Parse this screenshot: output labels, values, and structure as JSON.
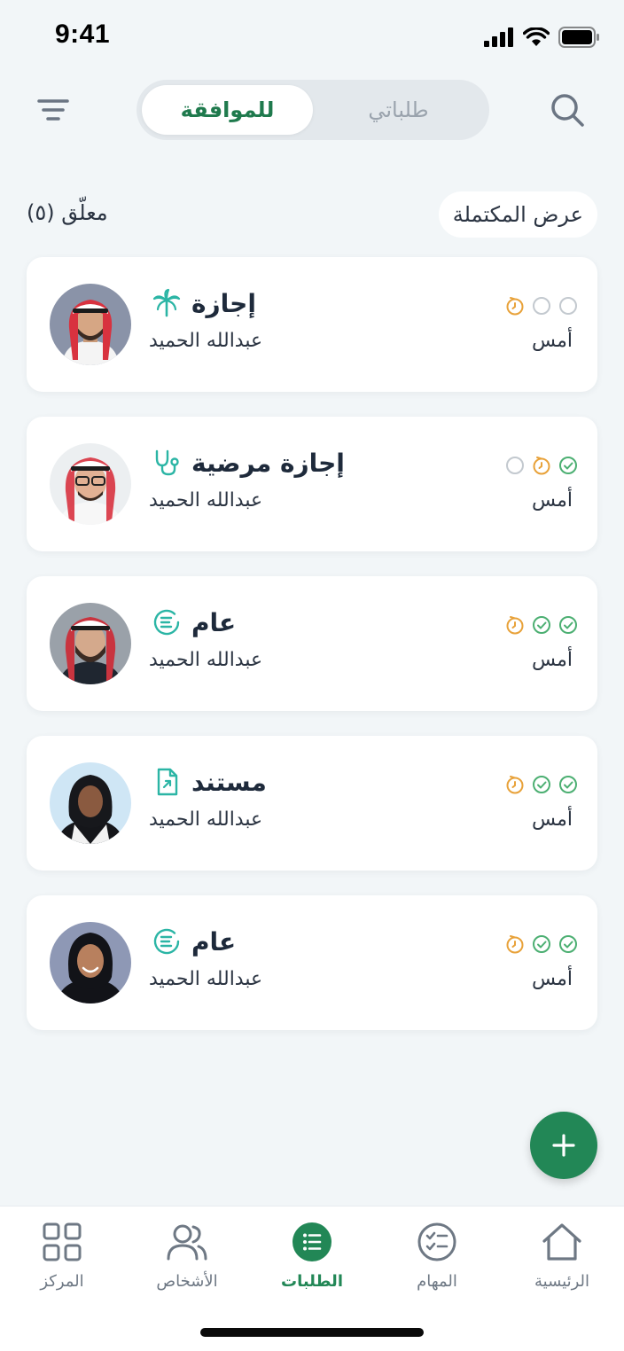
{
  "status": {
    "time": "9:41"
  },
  "segments": {
    "approval": "للموافقة",
    "mine": "طلباتي"
  },
  "section": {
    "pending_label": "معلّق (٥)",
    "show_completed": "عرض المكتملة"
  },
  "requests": [
    {
      "type": "إجازة",
      "icon": "palm-tree-icon",
      "requester": "عبدالله الحميد",
      "date": "أمس",
      "steps": [
        "pending",
        "empty",
        "empty"
      ]
    },
    {
      "type": "إجازة مرضية",
      "icon": "stethoscope-icon",
      "requester": "عبدالله الحميد",
      "date": "أمس",
      "steps": [
        "done",
        "pending",
        "empty"
      ]
    },
    {
      "type": "عام",
      "icon": "general-list-icon",
      "requester": "عبدالله الحميد",
      "date": "أمس",
      "steps": [
        "done",
        "done",
        "pending"
      ]
    },
    {
      "type": "مستند",
      "icon": "document-icon",
      "requester": "عبدالله الحميد",
      "date": "أمس",
      "steps": [
        "done",
        "done",
        "pending"
      ]
    },
    {
      "type": "عام",
      "icon": "general-list-icon",
      "requester": "عبدالله الحميد",
      "date": "أمس",
      "steps": [
        "done",
        "done",
        "pending"
      ]
    }
  ],
  "tabs": {
    "center": "المركز",
    "people": "الأشخاص",
    "requests": "الطلبات",
    "tasks": "المهام",
    "home": "الرئيسية"
  },
  "colors": {
    "accent": "#228756",
    "done": "#4caf72",
    "pending": "#e8a23a",
    "empty": "#c3c9cf",
    "icon_teal": "#2bb5a5"
  }
}
